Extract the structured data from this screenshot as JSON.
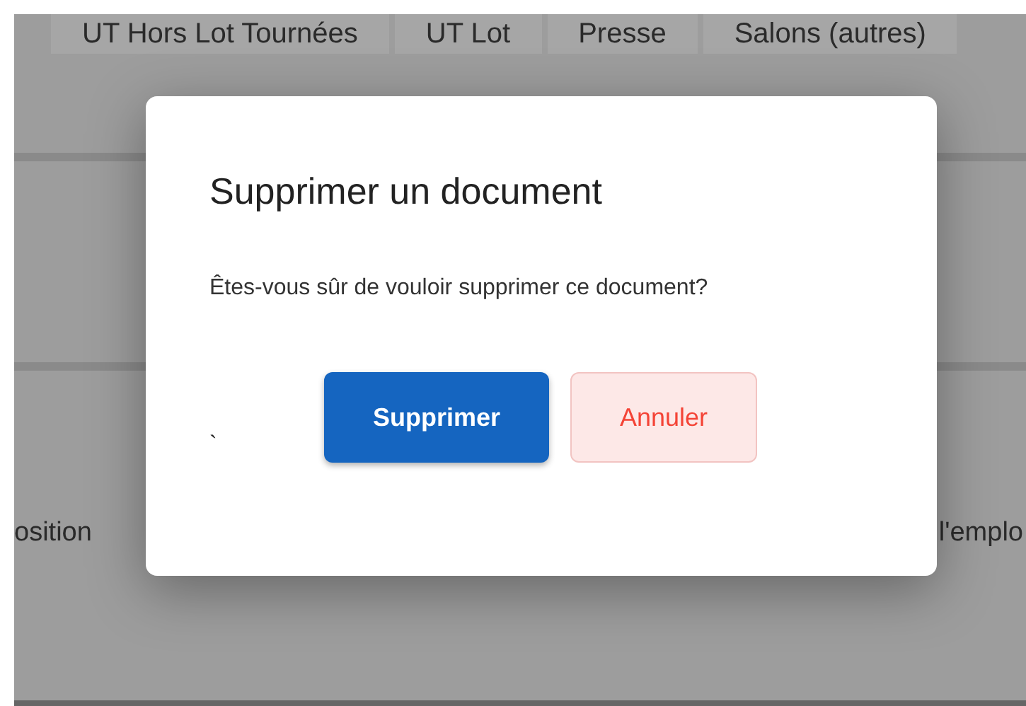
{
  "background": {
    "tabs": [
      {
        "label": "UT Hors Lot Tournées"
      },
      {
        "label": "UT Lot"
      },
      {
        "label": "Presse"
      },
      {
        "label": "Salons (autres)"
      }
    ],
    "row_left": "osition",
    "row_right": "l'emplo"
  },
  "dialog": {
    "title": "Supprimer un document",
    "message": "Êtes-vous sûr de vouloir supprimer ce document?",
    "stray_mark": "`",
    "buttons": [
      {
        "label": "Supprimer",
        "kind": "primary"
      },
      {
        "label": "Annuler",
        "kind": "cancel"
      }
    ]
  }
}
